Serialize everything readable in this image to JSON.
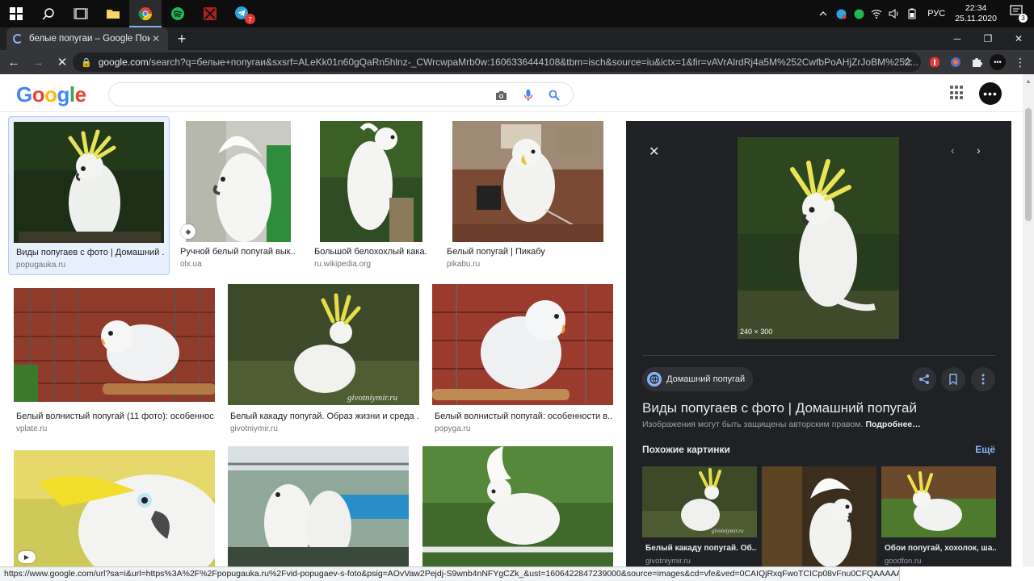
{
  "taskbar": {
    "apps": [
      "windows-start",
      "search",
      "task-view",
      "file-explorer",
      "chrome",
      "spotify",
      "dota",
      "telegram"
    ],
    "telegram_badge": "7",
    "tray": {
      "lang": "РУС",
      "time": "22:34",
      "date": "25.11.2020",
      "notifications": "3"
    }
  },
  "browser": {
    "tab_title": "белые попугаи – Google Поиск",
    "url_host": "google.com",
    "url_rest": "/search?q=белые+попугаи&sxsrf=ALeKk01n60gQaRn5hlnz-_CWrcwpaMrb0w:1606336444108&tbm=isch&source=iu&ictx=1&fir=vAVrAlrdRj4a5M%252CwfbPoAHjZrJoBM%252..."
  },
  "google": {
    "logo": "Google",
    "search_value": "",
    "avatar_glyph": "•••"
  },
  "results": [
    {
      "caption": "Виды попугаев с фото | Домашний ...",
      "source": "popugauka.ru"
    },
    {
      "caption": "Ручной белый попугай вык...",
      "source": "olx.ua"
    },
    {
      "caption": "Большой белохохлый кака...",
      "source": "ru.wikipedia.org"
    },
    {
      "caption": "Белый попугай | Пикабу",
      "source": "pikabu.ru"
    },
    {
      "caption": "Белый волнистый попугай (11 фото): особеннос...",
      "source": "vplate.ru"
    },
    {
      "caption": "Белый какаду попугай. Образ жизни и среда ...",
      "source": "givotniymir.ru"
    },
    {
      "caption": "Белый волнистый попугай: особенности в...",
      "source": "popyga.ru"
    }
  ],
  "panel": {
    "dims": "240 × 300",
    "site": "Домашний попугай",
    "title": "Виды попугаев с фото | Домашний попугай",
    "note": "Изображения могут быть защищены авторским правом.",
    "note_link": "Подробнее…",
    "similar_label": "Похожие картинки",
    "more_label": "Ещё",
    "related": [
      {
        "caption": "Белый какаду попугай. Об...",
        "source": "givotniymir.ru"
      },
      {
        "caption": "",
        "source": ""
      },
      {
        "caption": "Обои попугай, хохолок, ша...",
        "source": "goodfon.ru"
      }
    ]
  },
  "status_url": "https://www.google.com/url?sa=i&url=https%3A%2F%2Fpopugauka.ru%2Fvid-popugaev-s-foto&psig=AOvVaw2Pejdj-S9wnb4nNFYgCZk_&ust=1606422847239000&source=images&cd=vfe&ved=0CAIQjRxqFwoTCICp08vFnu0CFQAAAAAdAAAAABAD",
  "colors": {
    "accent_blue": "#4285f4",
    "panel_bg": "#202124",
    "selected_bg": "#e8f0fe"
  }
}
